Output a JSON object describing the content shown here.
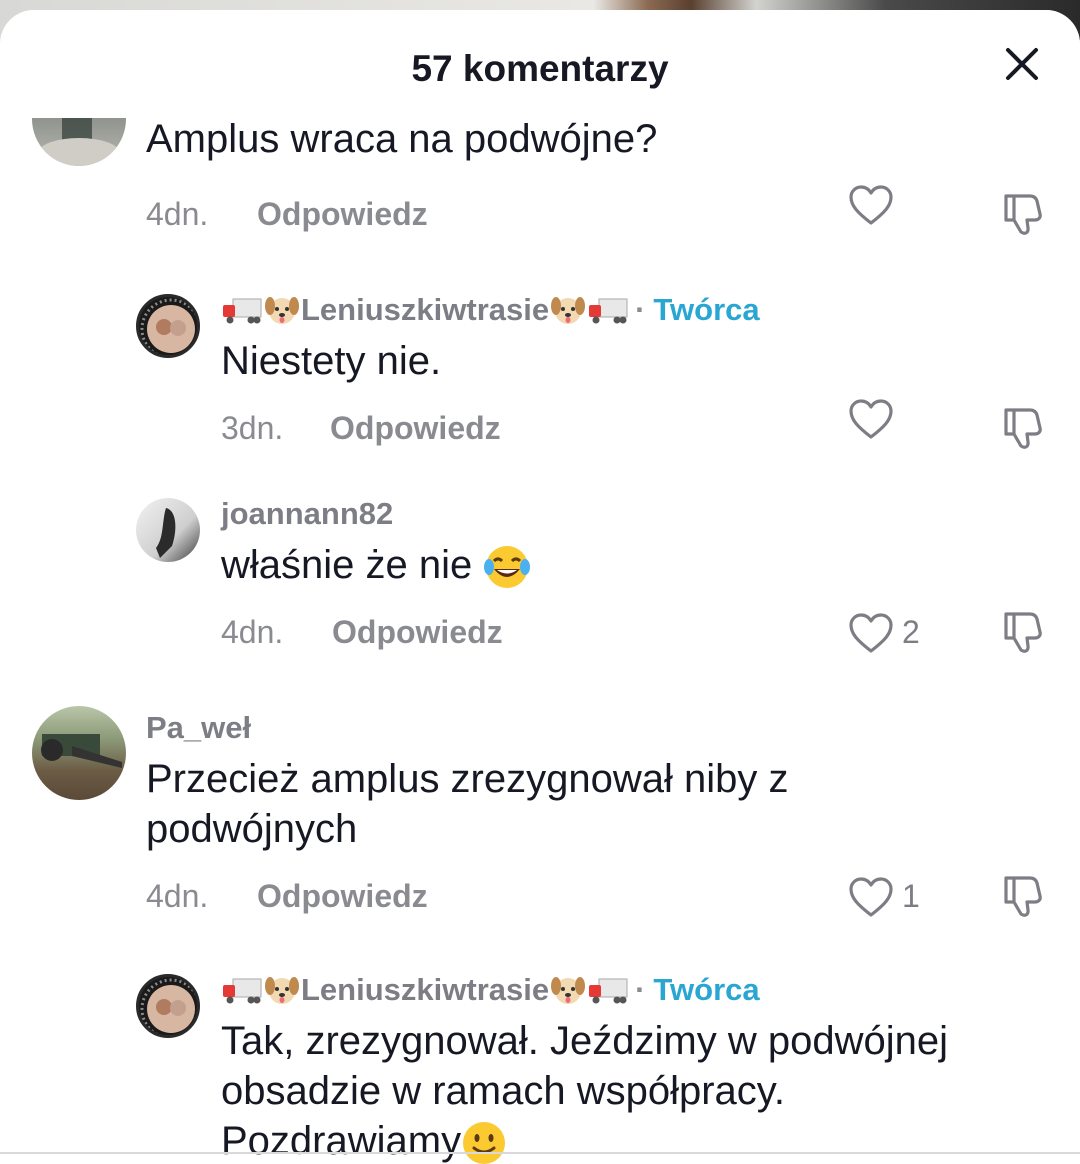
{
  "header": {
    "title": "57 komentarzy"
  },
  "comments": [
    {
      "text": "Amplus wraca na podwójne?",
      "time": "4dn.",
      "reply": "Odpowiedz"
    },
    {
      "username": "Leniuszkiwtrasie",
      "creator_label": "Twórca",
      "text": "Niestety nie.",
      "time": "3dn.",
      "reply": "Odpowiedz"
    },
    {
      "username": "joannann82",
      "text": "właśnie że nie",
      "time": "4dn.",
      "reply": "Odpowiedz",
      "likes": "2"
    },
    {
      "username": "Pa_weł",
      "text_line1": "Przecież amplus zrezygnował niby z",
      "text_line2": "podwójnych",
      "time": "4dn.",
      "reply": "Odpowiedz",
      "likes": "1"
    },
    {
      "username": "Leniuszkiwtrasie",
      "creator_label": "Twórca",
      "text_line1": "Tak, zrezygnował. Jeździmy w podwójnej",
      "text_line2": "obsadzie w ramach współpracy.",
      "text_line3": "Pozdrawiamy"
    }
  ],
  "colors": {
    "text": "#161823",
    "secondary": "#8a8b91",
    "creator": "#2aa6d3"
  }
}
